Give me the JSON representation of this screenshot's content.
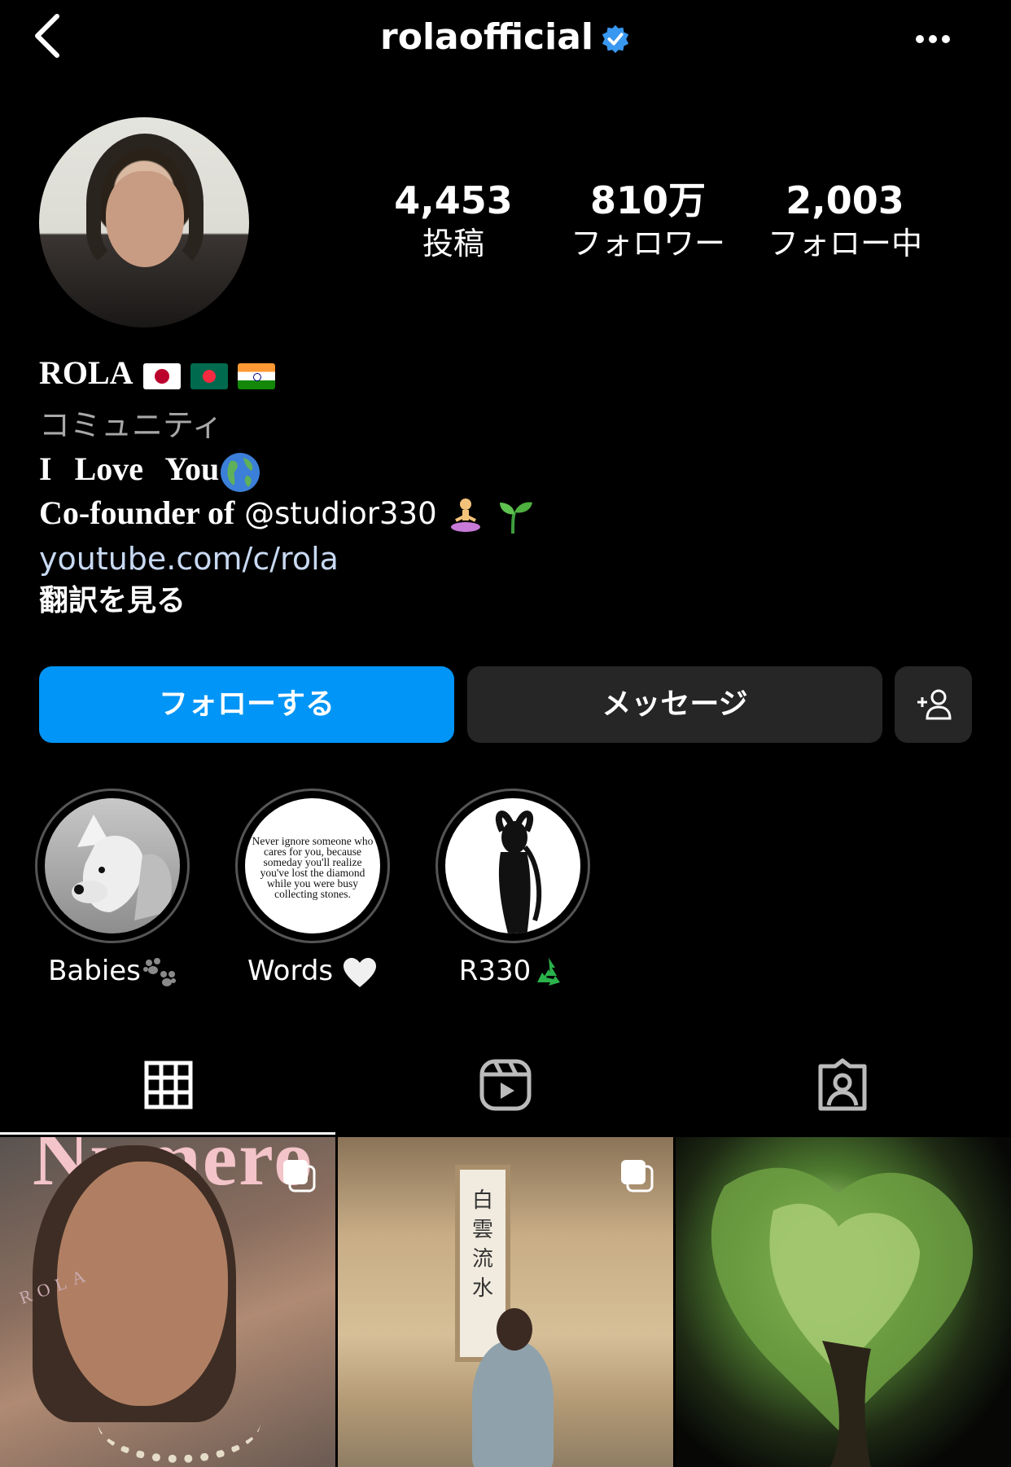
{
  "header": {
    "username": "rolaofficial",
    "verified": true
  },
  "stats": [
    {
      "value": "4,453",
      "label": "投稿"
    },
    {
      "value": "810万",
      "label": "フォロワー"
    },
    {
      "value": "2,003",
      "label": "フォロー中"
    }
  ],
  "bio": {
    "name": "ROLA",
    "category": "コミュニティ",
    "line1": "I Love You",
    "line2_prefix": "Co-founder of",
    "line2_mention": "@studior330",
    "link": "youtube.com/c/rola",
    "translate": "翻訳を見る"
  },
  "buttons": {
    "follow": "フォローする",
    "message": "メッセージ"
  },
  "highlights": [
    {
      "name": "Babies"
    },
    {
      "name": "Words"
    },
    {
      "name": "R330"
    }
  ],
  "words_highlight_text": "Never ignore someone who cares for you, because someday you'll realize you've lost the diamond while you were busy collecting stones.",
  "tiles": [
    {
      "magazine_title": "Numero",
      "magazine_label": "ROLA"
    },
    {
      "scroll_text": "白雲流水"
    },
    {}
  ],
  "colors": {
    "accent": "#0095f6",
    "button_dark": "#262626",
    "verified_badge": "#3897f0",
    "link": "#c8d9f2",
    "category": "#a8a8a8"
  }
}
